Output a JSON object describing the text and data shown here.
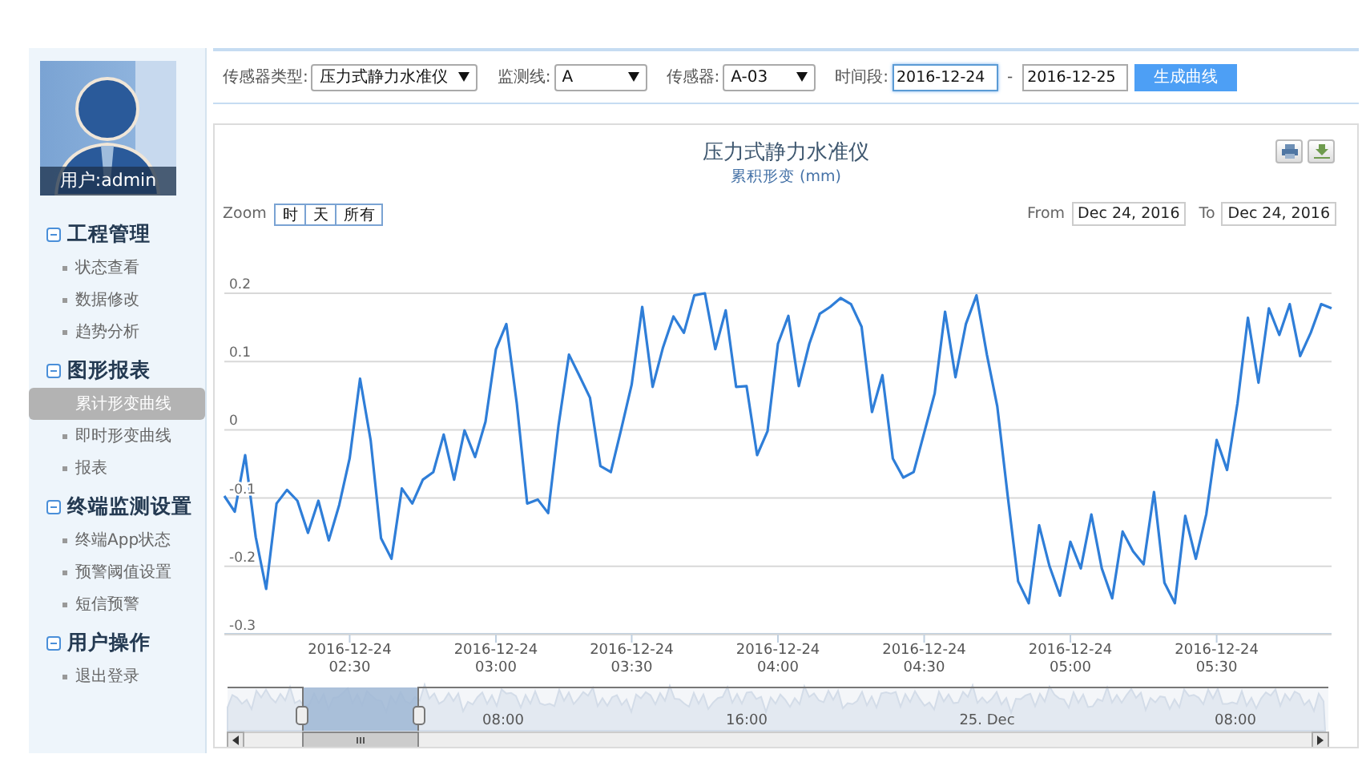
{
  "sidebar": {
    "user": {
      "caption": "用户:admin"
    },
    "groups": [
      {
        "title": "工程管理",
        "expanded": true,
        "items": [
          {
            "label": "状态查看",
            "selected": false
          },
          {
            "label": "数据修改",
            "selected": false
          },
          {
            "label": "趋势分析",
            "selected": false
          }
        ]
      },
      {
        "title": "图形报表",
        "expanded": true,
        "items": [
          {
            "label": "累计形变曲线",
            "selected": true
          },
          {
            "label": "即时形变曲线",
            "selected": false
          },
          {
            "label": "报表",
            "selected": false
          }
        ]
      },
      {
        "title": "终端监测设置",
        "expanded": true,
        "items": [
          {
            "label": "终端App状态",
            "selected": false
          },
          {
            "label": "预警阈值设置",
            "selected": false
          },
          {
            "label": "短信预警",
            "selected": false
          }
        ]
      },
      {
        "title": "用户操作",
        "expanded": true,
        "items": [
          {
            "label": "退出登录",
            "selected": false
          }
        ]
      }
    ]
  },
  "filters": {
    "fields": [
      {
        "kind": "select",
        "label": "传感器类型:",
        "value": "压力式静力水准仪"
      },
      {
        "kind": "select",
        "label": "监测线:",
        "value": "A"
      },
      {
        "kind": "select",
        "label": "传感器:",
        "value": "A-03"
      },
      {
        "kind": "date-range",
        "label": "时间段:",
        "from": {
          "value": "2016-12-24",
          "focused": true
        },
        "separator": "-",
        "to": {
          "value": "2016-12-25",
          "focused": false
        }
      }
    ],
    "button": "生成曲线"
  },
  "chart_panel": {
    "title": "压力式静力水准仪",
    "subtitle": "累积形变 (mm)",
    "zoom": {
      "label": "Zoom",
      "buttons": [
        "时",
        "天",
        "所有"
      ]
    },
    "range": {
      "from_label": "From",
      "from": "Dec 24, 2016",
      "to_label": "To",
      "to": "Dec 24, 2016"
    },
    "chart_data": {
      "type": "line",
      "grid": true,
      "ylim": [
        -0.3,
        0.2
      ],
      "yticks": [
        0.2,
        0.1,
        0,
        -0.1,
        -0.2,
        -0.3
      ],
      "categories": [
        null,
        null,
        null,
        null,
        null,
        null,
        null,
        null,
        null,
        null,
        null,
        null,
        "2016-12-24 02:30",
        null,
        null,
        null,
        null,
        null,
        null,
        null,
        null,
        null,
        null,
        null,
        null,
        null,
        "2016-12-24 03:00",
        null,
        null,
        null,
        null,
        null,
        null,
        null,
        null,
        null,
        null,
        null,
        null,
        "2016-12-24 03:30",
        null,
        null,
        null,
        null,
        null,
        null,
        null,
        null,
        null,
        null,
        null,
        null,
        null,
        "2016-12-24 04:00",
        null,
        null,
        null,
        null,
        null,
        null,
        null,
        null,
        null,
        null,
        null,
        null,
        null,
        "2016-12-24 04:30",
        null,
        null,
        null,
        null,
        null,
        null,
        null,
        null,
        null,
        null,
        null,
        null,
        null,
        "2016-12-24 05:00",
        null,
        null,
        null,
        null,
        null,
        null,
        null,
        null,
        null,
        null,
        null,
        null,
        null,
        "2016-12-24 05:30",
        null,
        null,
        null,
        null,
        null,
        null,
        null,
        null,
        null,
        null,
        null
      ],
      "series": [
        {
          "color": "#2f7ed8",
          "values": [
            -0.097,
            -0.12,
            -0.037,
            -0.157,
            -0.233,
            -0.108,
            -0.088,
            -0.104,
            -0.151,
            -0.104,
            -0.162,
            -0.11,
            -0.042,
            0.075,
            -0.015,
            -0.159,
            -0.189,
            -0.086,
            -0.108,
            -0.073,
            -0.062,
            -0.007,
            -0.073,
            -0.001,
            -0.04,
            0.012,
            0.118,
            0.155,
            0.039,
            -0.108,
            -0.102,
            -0.122,
            0.007,
            0.11,
            0.079,
            0.047,
            -0.053,
            -0.062,
            0.001,
            0.066,
            0.18,
            0.063,
            0.121,
            0.166,
            0.142,
            0.197,
            0.2,
            0.118,
            0.175,
            0.063,
            0.064,
            -0.037,
            -0.002,
            0.126,
            0.167,
            0.064,
            0.126,
            0.17,
            0.18,
            0.193,
            0.184,
            0.151,
            0.026,
            0.08,
            -0.042,
            -0.07,
            -0.062,
            -0.004,
            0.053,
            0.173,
            0.077,
            0.155,
            0.197,
            0.11,
            0.034,
            -0.097,
            -0.222,
            -0.254,
            -0.14,
            -0.2,
            -0.243,
            -0.164,
            -0.203,
            -0.124,
            -0.203,
            -0.247,
            -0.149,
            -0.178,
            -0.197,
            -0.091,
            -0.224,
            -0.254,
            -0.126,
            -0.189,
            -0.124,
            -0.015,
            -0.059,
            0.039,
            0.164,
            0.069,
            0.178,
            0.139,
            0.184,
            0.108,
            0.142,
            0.184,
            0.178
          ]
        }
      ]
    },
    "navigator": {
      "labels": [
        "08:00",
        "16:00",
        "25. Dec",
        "08:00"
      ]
    }
  }
}
